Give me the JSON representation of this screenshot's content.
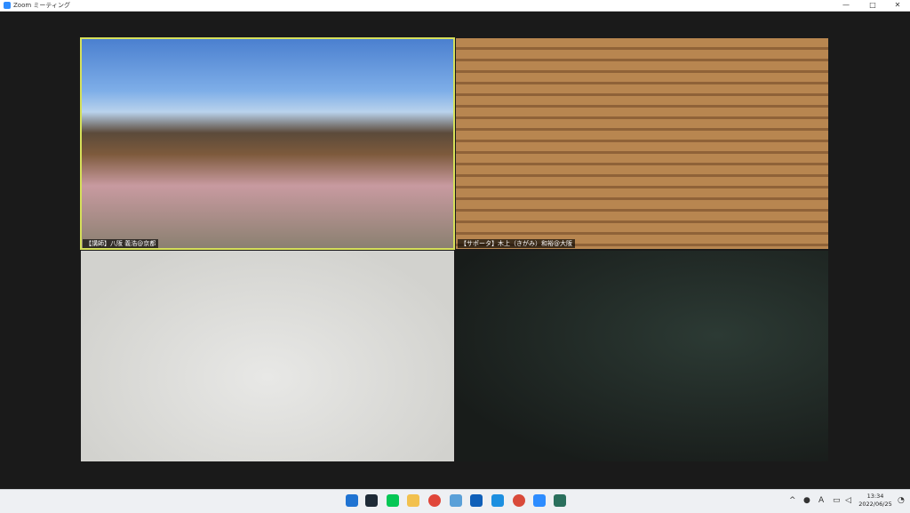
{
  "window": {
    "title": "Zoom ミーティング"
  },
  "window_controls": {
    "minimize": "—",
    "maximize": "□",
    "close": "✕"
  },
  "participants": [
    {
      "name": "【講師】八阪 義浩@京都",
      "active_speaker": true
    },
    {
      "name": "【サポータ】木上（きがみ）和裕@大阪",
      "active_speaker": false
    },
    {
      "name": "",
      "active_speaker": false
    },
    {
      "name": "",
      "active_speaker": false
    }
  ],
  "taskbar": {
    "apps": [
      "start-icon",
      "terminal-icon",
      "line-icon",
      "file-explorer-icon",
      "chrome-icon",
      "notepad-icon",
      "outlook-icon",
      "screen-icon",
      "chrome-icon",
      "zoom-icon",
      "app-icon"
    ],
    "clock": {
      "time": "13:34",
      "date": "2022/06/25"
    },
    "tray": {
      "ime": "A"
    }
  },
  "colors": {
    "active_border": "#d6e05a",
    "accent": "#2d8cff"
  }
}
